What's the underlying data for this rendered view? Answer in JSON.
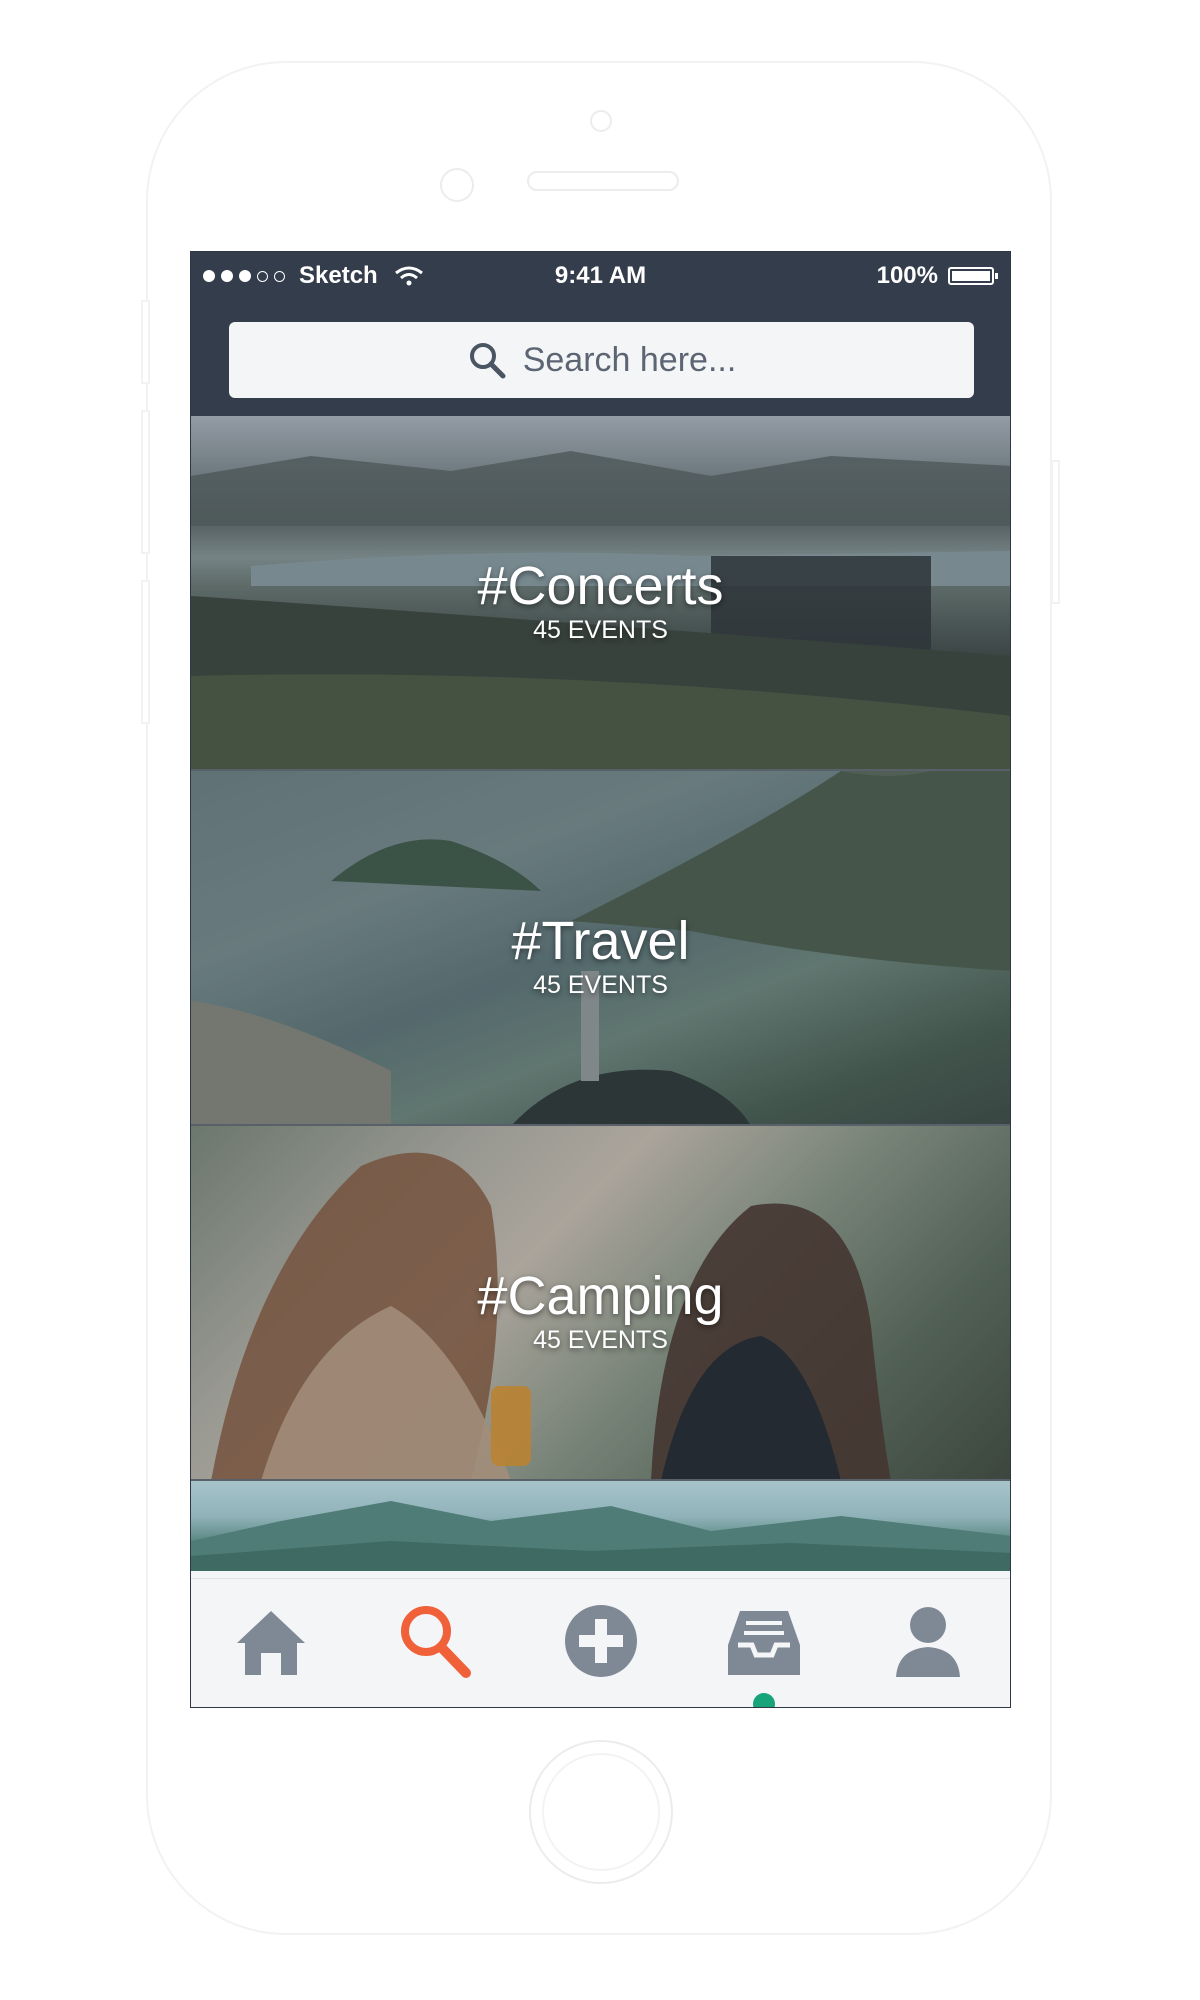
{
  "status_bar": {
    "carrier": "Sketch",
    "time": "9:41 AM",
    "battery": "100%",
    "signal_dots_filled": 3,
    "signal_dots_total": 5
  },
  "search": {
    "placeholder": "Search here..."
  },
  "categories": [
    {
      "name": "#Concerts",
      "count": "45 EVENTS"
    },
    {
      "name": "#Travel",
      "count": "45 EVENTS"
    },
    {
      "name": "#Camping",
      "count": "45 EVENTS"
    }
  ],
  "tab_bar": {
    "items": [
      {
        "icon": "home-icon"
      },
      {
        "icon": "search-icon",
        "active": true
      },
      {
        "icon": "add-icon"
      },
      {
        "icon": "inbox-icon",
        "has_notification": true
      },
      {
        "icon": "profile-icon"
      }
    ]
  },
  "colors": {
    "header": "#343d4b",
    "active_tab": "#f0613a",
    "inactive_tab": "#7f8996",
    "notification_dot": "#17a47a"
  }
}
